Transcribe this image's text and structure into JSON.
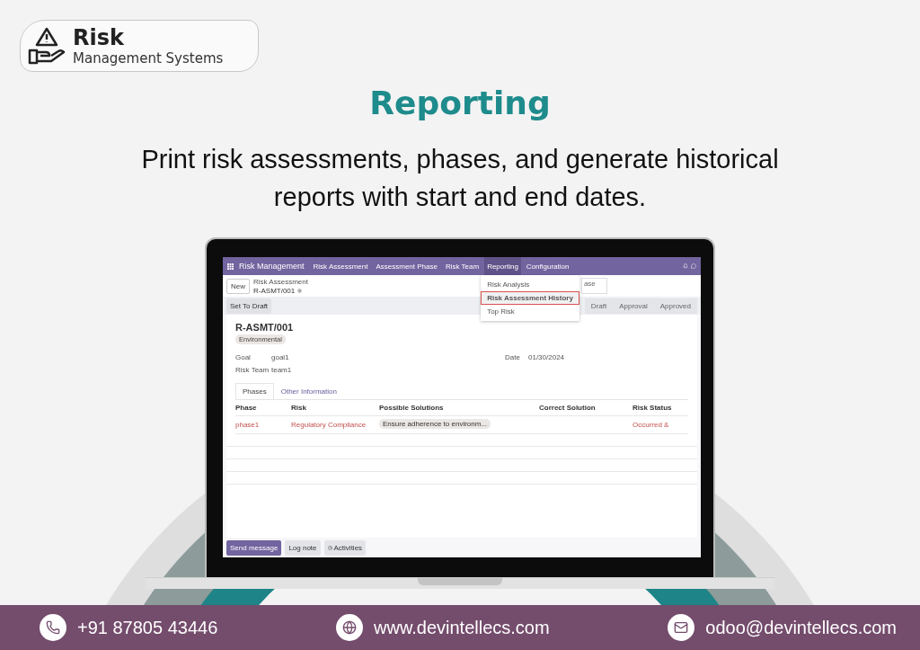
{
  "logo": {
    "title": "Risk",
    "subtitle": "Management Systems"
  },
  "heading": "Reporting",
  "subheading": "Print risk assessments, phases, and generate historical reports with start and end dates.",
  "app": {
    "brand": "Risk Management",
    "menu": [
      {
        "label": "Risk Assessment",
        "selected": false
      },
      {
        "label": "Assessment Phase",
        "selected": false
      },
      {
        "label": "Risk Team",
        "selected": false
      },
      {
        "label": "Reporting",
        "selected": true
      },
      {
        "label": "Configuration",
        "selected": false
      }
    ],
    "dropdown": [
      {
        "label": "Risk Analysis",
        "selected": false
      },
      {
        "label": "Risk Assessment History",
        "selected": true
      },
      {
        "label": "Top Risk",
        "selected": false
      }
    ],
    "new_button": "New",
    "breadcrumb": {
      "parent": "Risk Assessment",
      "current": "R-ASMT/001"
    },
    "partial_box": "ase",
    "action_button": "Set To Draft",
    "stages": [
      "Draft",
      "Approval",
      "Approved"
    ],
    "record": {
      "name": "R-ASMT/001",
      "tag": "Environmental",
      "fields_left": [
        {
          "label": "Goal",
          "value": "goal1"
        },
        {
          "label": "Risk Team",
          "value": "team1"
        }
      ],
      "fields_right": [
        {
          "label": "Date",
          "value": "01/30/2024"
        }
      ]
    },
    "tabs": [
      {
        "label": "Phases",
        "selected": true
      },
      {
        "label": "Other Information",
        "selected": false
      }
    ],
    "columns": [
      "Phase",
      "Risk",
      "Possible Solutions",
      "Correct Solution",
      "Risk Status"
    ],
    "rows": [
      {
        "phase": "phase1",
        "risk": "Regulatory Compliance",
        "solution": "Ensure adherence to environm...",
        "correct": "",
        "status": "Occurred &"
      }
    ],
    "chatter": [
      {
        "label": "Send message",
        "kind": "primary"
      },
      {
        "label": "Log note",
        "kind": "plain"
      },
      {
        "label": "Activities",
        "kind": "activity"
      }
    ]
  },
  "contacts": [
    {
      "kind": "phone",
      "text": "+91 87805 43446"
    },
    {
      "kind": "web",
      "text": "www.devintellecs.com"
    },
    {
      "kind": "mail",
      "text": "odoo@devintellecs.com"
    }
  ]
}
